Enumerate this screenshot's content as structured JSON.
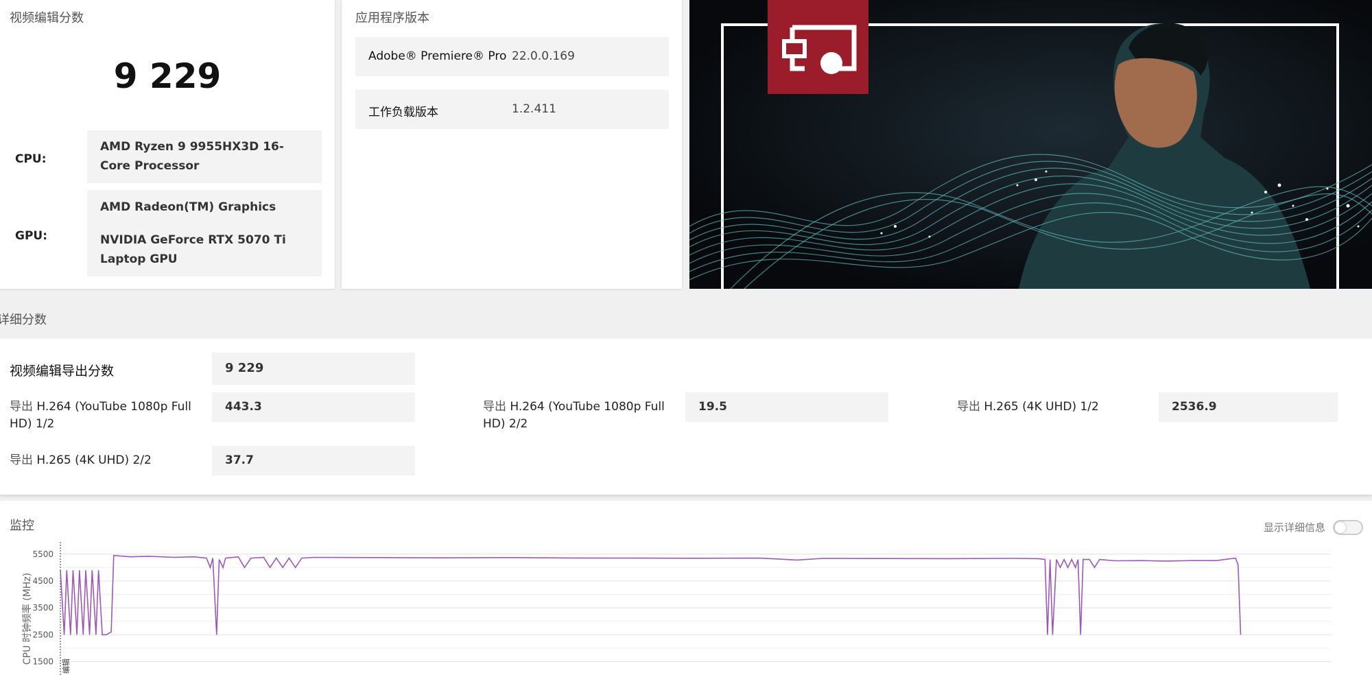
{
  "score_card": {
    "title": "视频编辑分数",
    "score": "9 229",
    "cpu_label": "CPU:",
    "cpu_value": "AMD Ryzen 9 9955HX3D 16-Core Processor",
    "gpu_label": "GPU:",
    "gpu_value_1": "AMD Radeon(TM) Graphics",
    "gpu_value_2": "NVIDIA GeForce RTX 5070 Ti Laptop GPU"
  },
  "version_card": {
    "title": "应用程序版本",
    "rows": [
      {
        "label": "Adobe® Premiere® Pro",
        "value": "22.0.0.169"
      },
      {
        "label": "工作负载版本",
        "value": "1.2.411"
      }
    ]
  },
  "detail": {
    "title": "详细分数",
    "main_label": "视频编辑导出分数",
    "main_value": "9 229",
    "items": [
      {
        "prefix": "导出",
        "label": " H.264 (YouTube 1080p Full HD) 1/2",
        "value": "443.3"
      },
      {
        "prefix": "导出",
        "label": " H.264 (YouTube 1080p Full HD) 2/2",
        "value": "19.5"
      },
      {
        "prefix": "导出",
        "label": " H.265 (4K UHD) 1/2",
        "value": "2536.9"
      },
      {
        "prefix": "导出",
        "label": " H.265 (4K UHD) 2/2",
        "value": "37.7"
      }
    ]
  },
  "monitor": {
    "title": "监控",
    "toggle_label": "显示详细信息",
    "toggle_on": false,
    "marker_label": "编辑"
  },
  "colors": {
    "accent_red": "#9b1c2a",
    "line_purple": "#9b59b6",
    "hero_bg": "#0d1117",
    "wave_teal": "#5fb8b8"
  },
  "chart_data": {
    "type": "line",
    "title": "",
    "xlabel": "",
    "ylabel": "CPU 时钟频率 (MHz)",
    "yticks": [
      1500,
      2500,
      3500,
      4500,
      5500
    ],
    "ylim": [
      1000,
      5800
    ],
    "xlim": [
      0,
      100
    ],
    "series": [
      {
        "values": [
          [
            0,
            4900
          ],
          [
            0.3,
            2500
          ],
          [
            0.5,
            4900
          ],
          [
            0.8,
            2500
          ],
          [
            1.0,
            4900
          ],
          [
            1.3,
            2500
          ],
          [
            1.5,
            4900
          ],
          [
            1.8,
            2500
          ],
          [
            2.0,
            4900
          ],
          [
            2.3,
            2500
          ],
          [
            2.5,
            4900
          ],
          [
            2.8,
            2500
          ],
          [
            3.0,
            4900
          ],
          [
            3.3,
            2500
          ],
          [
            3.6,
            2500
          ],
          [
            4.0,
            2600
          ],
          [
            4.2,
            5450
          ],
          [
            5.5,
            5400
          ],
          [
            7,
            5420
          ],
          [
            9,
            5380
          ],
          [
            10.5,
            5400
          ],
          [
            11.5,
            5350
          ],
          [
            11.8,
            5000
          ],
          [
            12.0,
            5350
          ],
          [
            12.3,
            2500
          ],
          [
            12.5,
            5300
          ],
          [
            12.8,
            5000
          ],
          [
            13.0,
            5350
          ],
          [
            14,
            5400
          ],
          [
            14.5,
            5000
          ],
          [
            15,
            5350
          ],
          [
            16,
            5380
          ],
          [
            16.5,
            5000
          ],
          [
            17,
            5350
          ],
          [
            17.5,
            5000
          ],
          [
            18,
            5350
          ],
          [
            18.5,
            5000
          ],
          [
            19,
            5350
          ],
          [
            20,
            5380
          ],
          [
            25,
            5370
          ],
          [
            30,
            5360
          ],
          [
            35,
            5370
          ],
          [
            40,
            5355
          ],
          [
            45,
            5350
          ],
          [
            50,
            5345
          ],
          [
            55,
            5350
          ],
          [
            58,
            5280
          ],
          [
            60,
            5340
          ],
          [
            65,
            5335
          ],
          [
            70,
            5330
          ],
          [
            75,
            5340
          ],
          [
            77,
            5330
          ],
          [
            77.5,
            5300
          ],
          [
            77.7,
            2500
          ],
          [
            77.9,
            5300
          ],
          [
            78.1,
            2500
          ],
          [
            78.4,
            5300
          ],
          [
            78.7,
            5000
          ],
          [
            79,
            5300
          ],
          [
            79.3,
            5000
          ],
          [
            79.6,
            5300
          ],
          [
            79.9,
            5000
          ],
          [
            80.1,
            5300
          ],
          [
            80.3,
            2500
          ],
          [
            80.5,
            5300
          ],
          [
            81,
            5300
          ],
          [
            81.4,
            5000
          ],
          [
            81.8,
            5300
          ],
          [
            83,
            5250
          ],
          [
            85,
            5260
          ],
          [
            87,
            5240
          ],
          [
            89,
            5260
          ],
          [
            91,
            5260
          ],
          [
            92.5,
            5350
          ],
          [
            92.7,
            5100
          ],
          [
            92.9,
            2500
          ]
        ]
      }
    ],
    "markers": [
      {
        "x": 0,
        "label": "编辑"
      }
    ]
  }
}
